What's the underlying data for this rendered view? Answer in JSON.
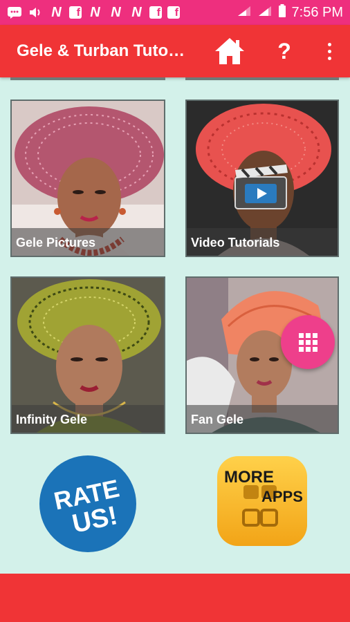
{
  "status_bar": {
    "time": "7:56 PM",
    "icons": [
      "message-icon",
      "volume-icon",
      "n-app-icon",
      "facebook-icon",
      "n-app-icon",
      "n-app-icon",
      "n-app-icon",
      "facebook-icon",
      "facebook-icon",
      "signal-icon",
      "signal-icon",
      "battery-icon"
    ]
  },
  "toolbar": {
    "title": "Gele & Turban Tutorials",
    "home_icon": "home-icon",
    "help_label": "?",
    "more_icon": "more-vert-icon"
  },
  "tiles": [
    {
      "label": "Gele Pictures",
      "colors": {
        "headwrap": "#b4566f",
        "bg": "#c9b8b8"
      }
    },
    {
      "label": "Video Tutorials",
      "colors": {
        "headwrap": "#e8524f",
        "bg": "#2b2b2b"
      }
    },
    {
      "label": "Infinity Gele",
      "colors": {
        "headwrap": "#a0a334",
        "bg": "#5c5a4e"
      }
    },
    {
      "label": "Fan Gele",
      "colors": {
        "headwrap": "#f08463",
        "bg": "#b7a9a8"
      }
    }
  ],
  "rate_button": {
    "line1": "RATE",
    "line2": "US!",
    "color": "#1b73b8"
  },
  "more_apps_button": {
    "line1": "MORE",
    "line2": "APPS",
    "color": "#f2b21c"
  },
  "fab": {
    "icon": "apps-grid-icon",
    "color": "#ee3f8b"
  },
  "colors": {
    "status_bar": "#ee2f7e",
    "toolbar": "#f03436",
    "background": "#d3f1ea"
  }
}
